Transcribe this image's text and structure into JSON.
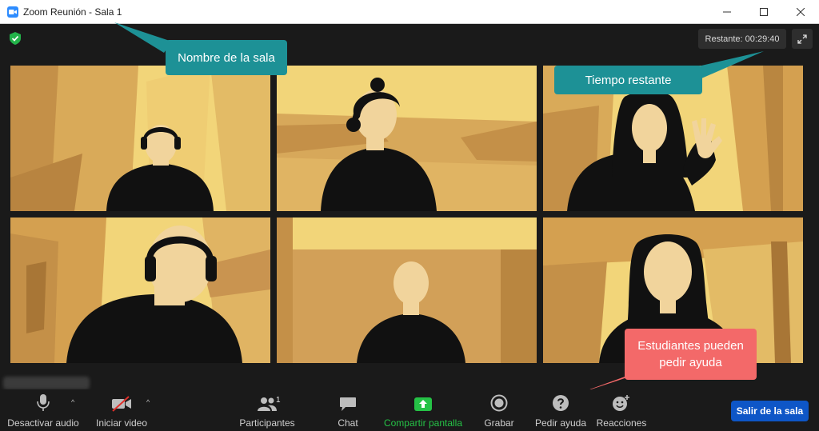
{
  "window": {
    "title": "Zoom Reunión - Sala 1"
  },
  "meeting": {
    "remaining_label": "Restante: 00:29:40"
  },
  "annotations": {
    "room_name": "Nombre de la sala",
    "time_left": "Tiempo restante",
    "help_line1": "Estudiantes pueden",
    "help_line2": "pedir ayuda"
  },
  "toolbar": {
    "mute_label": "Desactivar audio",
    "video_label": "Iniciar video",
    "participants_label": "Participantes",
    "participants_count": "1",
    "chat_label": "Chat",
    "share_label": "Compartir pantalla",
    "record_label": "Grabar",
    "help_label": "Pedir ayuda",
    "reactions_label": "Reacciones",
    "leave_label": "Salir de la sala"
  },
  "colors": {
    "annotation_teal": "#1d9196",
    "annotation_red": "#f36969",
    "share_green": "#25c246",
    "leave_blue": "#0e56c7",
    "tile_light": "#f2d579",
    "tile_dark": "#c79a4f"
  },
  "icons": {
    "app": "zoom-camera-icon",
    "security": "shield-check-icon",
    "fullscreen": "expand-icon",
    "mute": "microphone-icon",
    "video": "video-off-icon",
    "participants": "people-icon",
    "chat": "speech-bubble-icon",
    "share": "share-screen-icon",
    "record": "record-icon",
    "help": "question-icon",
    "reactions": "smiley-plus-icon"
  }
}
